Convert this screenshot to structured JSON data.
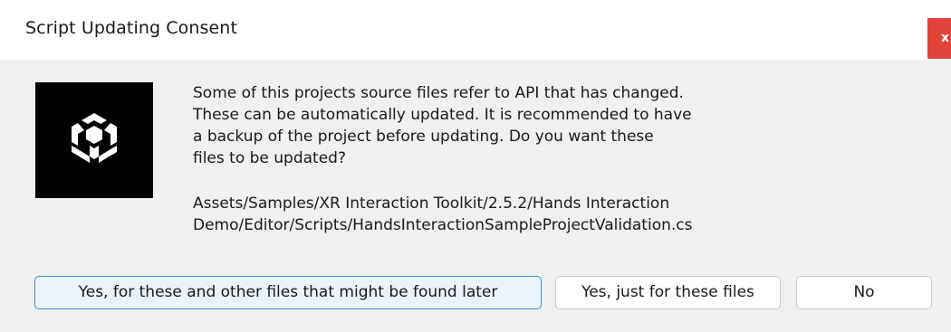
{
  "window": {
    "title": "Script Updating Consent",
    "close_label": "x"
  },
  "icon": {
    "name": "unity-logo-icon"
  },
  "message": {
    "body": "Some of this projects source files refer to API that has changed.\nThese can be automatically updated. It is recommended to have\na backup of the project before updating. Do you want these\nfiles to be updated?",
    "file_path": "Assets/Samples/XR Interaction Toolkit/2.5.2/Hands Interaction\nDemo/Editor/Scripts/HandsInteractionSampleProjectValidation.cs"
  },
  "buttons": {
    "yes_all_label": "Yes, for these and other files that might be found later",
    "yes_these_label": "Yes, just for these files",
    "no_label": "No"
  },
  "colors": {
    "close_button": "#e0433a",
    "primary_button_border": "#3b8dd1",
    "logo_background": "#000000"
  }
}
